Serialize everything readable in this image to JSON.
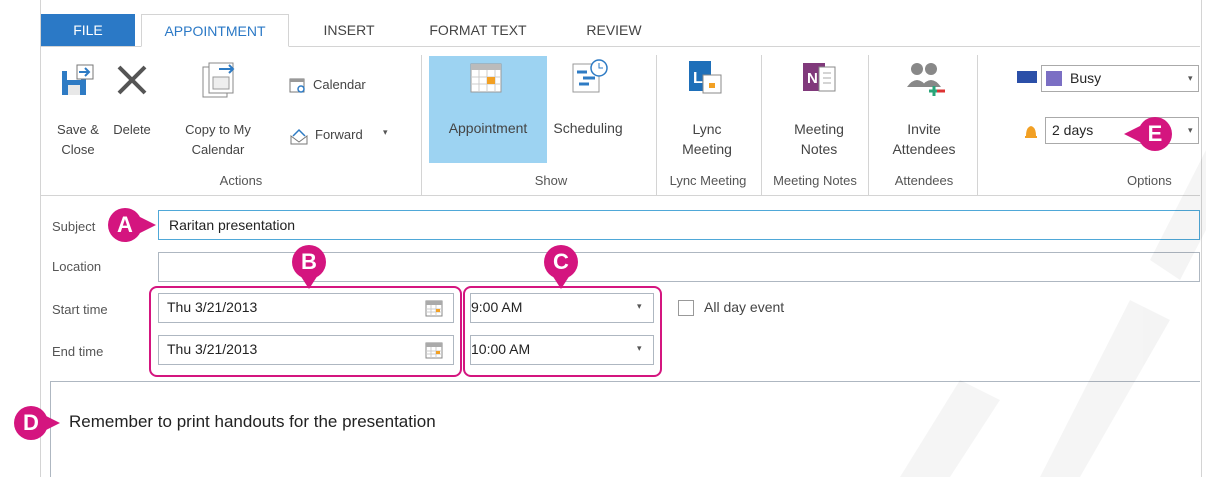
{
  "tabs": {
    "file": "FILE",
    "appointment": "APPOINTMENT",
    "insert": "INSERT",
    "format_text": "FORMAT TEXT",
    "review": "REVIEW"
  },
  "ribbon": {
    "save_close_1": "Save &",
    "save_close_2": "Close",
    "delete": "Delete",
    "copy_1": "Copy to My",
    "copy_2": "Calendar",
    "calendar": "Calendar",
    "forward": "Forward",
    "appointment": "Appointment",
    "scheduling": "Scheduling",
    "lync_1": "Lync",
    "lync_2": "Meeting",
    "notes_1": "Meeting",
    "notes_2": "Notes",
    "invite_1": "Invite",
    "invite_2": "Attendees",
    "show_as": "Busy",
    "reminder": "2 days",
    "groups": {
      "actions": "Actions",
      "show": "Show",
      "lync": "Lync Meeting",
      "notes": "Meeting Notes",
      "attendees": "Attendees",
      "options": "Options"
    }
  },
  "form": {
    "subject_label": "Subject",
    "subject_value": "Raritan presentation",
    "location_label": "Location",
    "location_value": "",
    "start_label": "Start time",
    "start_date": "Thu 3/21/2013",
    "start_time": "9:00 AM",
    "all_day": "All day event",
    "end_label": "End time",
    "end_date": "Thu 3/21/2013",
    "end_time": "10:00 AM",
    "body": "Remember to print handouts for the presentation"
  },
  "callouts": {
    "a": "A",
    "b": "B",
    "c": "C",
    "d": "D",
    "e": "E"
  },
  "colors": {
    "accent": "#2b79c6",
    "callout": "#d4157f",
    "selected": "#9dd3f2",
    "busy": "#7b6fc4"
  }
}
